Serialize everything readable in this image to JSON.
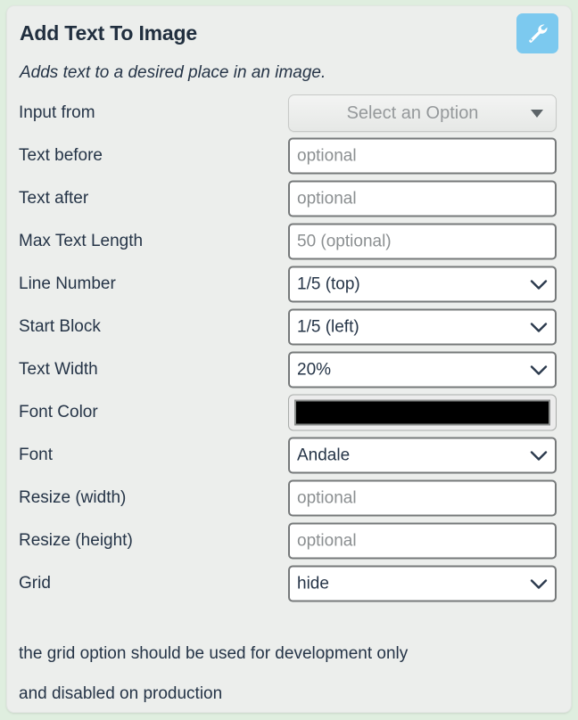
{
  "panel": {
    "title": "Add Text To Image",
    "subtitle": "Adds text to a desired place in an image.",
    "tool_button_icon": "wrench-icon",
    "accent_color": "#7cc9ef",
    "background_color": "#eceeec",
    "page_background_color": "#dfeedf",
    "text_color": "#253447"
  },
  "fields": {
    "input_from": {
      "label": "Input from",
      "type": "picker",
      "value": "Select an Option"
    },
    "text_before": {
      "label": "Text before",
      "type": "text",
      "value": "",
      "placeholder": "optional"
    },
    "text_after": {
      "label": "Text after",
      "type": "text",
      "value": "",
      "placeholder": "optional"
    },
    "max_text_length": {
      "label": "Max Text Length",
      "type": "text",
      "value": "",
      "placeholder": "50 (optional)"
    },
    "line_number": {
      "label": "Line Number",
      "type": "select",
      "value": "1/5 (top)"
    },
    "start_block": {
      "label": "Start Block",
      "type": "select",
      "value": "1/5 (left)"
    },
    "text_width": {
      "label": "Text Width",
      "type": "select",
      "value": "20%"
    },
    "font_color": {
      "label": "Font Color",
      "type": "color",
      "value": "#000000"
    },
    "font": {
      "label": "Font",
      "type": "select",
      "value": "Andale"
    },
    "resize_width": {
      "label": "Resize (width)",
      "type": "text",
      "value": "",
      "placeholder": "optional"
    },
    "resize_height": {
      "label": "Resize (height)",
      "type": "text",
      "value": "",
      "placeholder": "optional"
    },
    "grid": {
      "label": "Grid",
      "type": "select",
      "value": "hide"
    }
  },
  "note": {
    "line1": "the grid option should be used for development only",
    "line2": "and disabled on production"
  }
}
